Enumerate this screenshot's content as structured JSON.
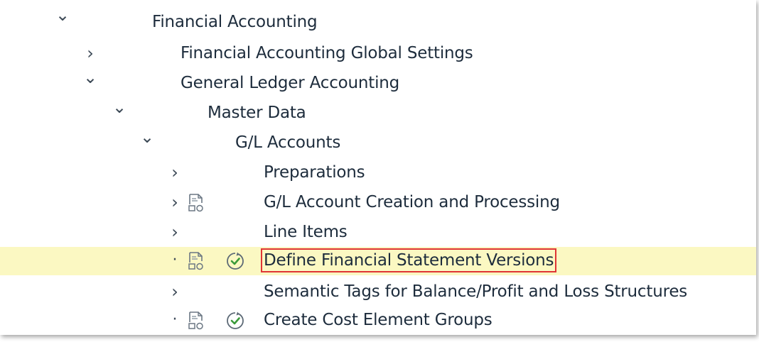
{
  "tree": {
    "nodes": [
      {
        "label": "Financial Accounting",
        "toggle": "expanded"
      },
      {
        "label": "Financial Accounting Global Settings",
        "toggle": "collapsed"
      },
      {
        "label": "General Ledger Accounting",
        "toggle": "expanded"
      },
      {
        "label": "Master Data",
        "toggle": "expanded"
      },
      {
        "label": "G/L Accounts",
        "toggle": "expanded"
      },
      {
        "label": "Preparations",
        "toggle": "collapsed"
      },
      {
        "label": "G/L Account Creation and Processing",
        "toggle": "collapsed",
        "doc_icon": "documentation-icon"
      },
      {
        "label": "Line Items",
        "toggle": "collapsed"
      },
      {
        "label": "Define Financial Statement Versions",
        "toggle": "leaf",
        "doc_icon": "documentation-icon",
        "exec_icon": "execute-icon",
        "selected": true
      },
      {
        "label": "Semantic Tags for Balance/Profit and Loss Structures",
        "toggle": "collapsed"
      },
      {
        "label": "Create Cost Element Groups",
        "toggle": "leaf",
        "doc_icon": "documentation-icon",
        "exec_icon": "execute-icon"
      }
    ],
    "glyphs": {
      "expanded": "⌄",
      "collapsed": "›",
      "leaf": "·"
    }
  },
  "colors": {
    "selection": "#fbf8c2",
    "focus_outline": "#e03535",
    "exec_icon": "#3b9b3a"
  }
}
